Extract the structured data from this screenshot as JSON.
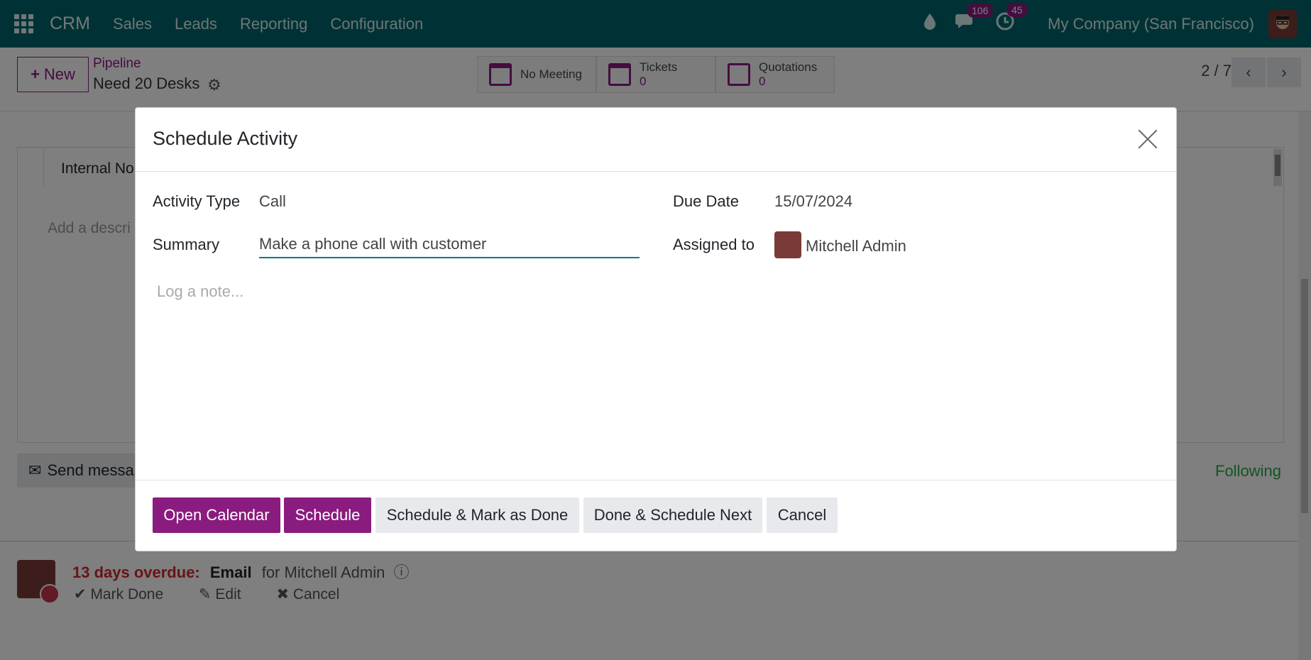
{
  "topnav": {
    "brand": "CRM",
    "menu": [
      "Sales",
      "Leads",
      "Reporting",
      "Configuration"
    ],
    "messages_count": "106",
    "activities_count": "45",
    "company": "My Company (San Francisco)"
  },
  "control": {
    "new_label": "New",
    "breadcrumb_parent": "Pipeline",
    "breadcrumb_current": "Need 20 Desks",
    "smart_buttons": {
      "meeting": "No Meeting",
      "tickets_label": "Tickets",
      "tickets_count": "0",
      "quotations_label": "Quotations",
      "quotations_count": "0"
    },
    "pager": "2 / 7"
  },
  "background": {
    "notes_tab": "Internal No",
    "description_placeholder": "Add a descri",
    "send_message": "Send messa",
    "following": "Following",
    "activity": {
      "overdue": "13 days overdue:",
      "type": "Email",
      "for": "for Mitchell Admin",
      "mark_done": "Mark Done",
      "edit": "Edit",
      "cancel": "Cancel"
    }
  },
  "modal": {
    "title": "Schedule Activity",
    "activity_type_label": "Activity Type",
    "activity_type_value": "Call",
    "summary_label": "Summary",
    "summary_value": "Make a phone call with customer",
    "due_date_label": "Due Date",
    "due_date_value": "15/07/2024",
    "assigned_to_label": "Assigned to",
    "assigned_to_value": "Mitchell Admin",
    "note_placeholder": "Log a note...",
    "buttons": {
      "open_calendar": "Open Calendar",
      "schedule": "Schedule",
      "schedule_mark_done": "Schedule & Mark as Done",
      "done_schedule_next": "Done & Schedule Next",
      "cancel": "Cancel"
    }
  },
  "colors": {
    "nav_bg": "#00646b",
    "primary": "#8a1b7f",
    "overdue": "#d3262f",
    "following": "#28a745"
  }
}
